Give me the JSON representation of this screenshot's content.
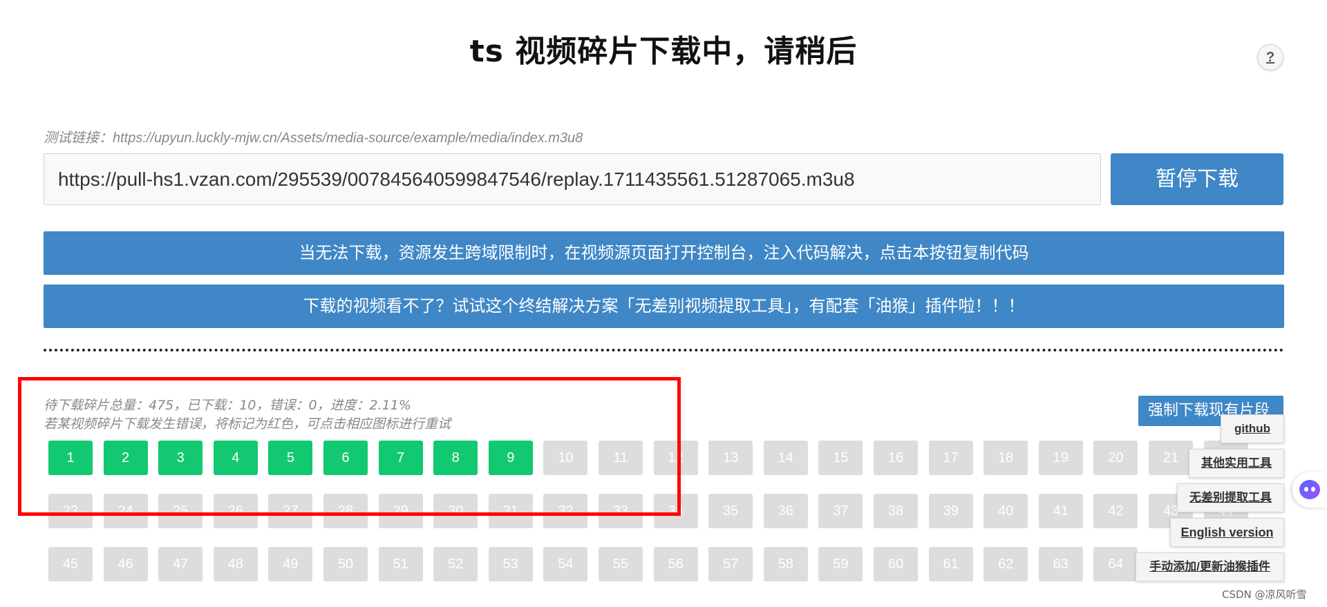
{
  "header": {
    "title": "ts 视频碎片下载中，请稍后",
    "help_label": "?"
  },
  "source": {
    "test_link": "测试链接：https://upyun.luckly-mjw.cn/Assets/media-source/example/media/index.m3u8",
    "url_value": "https://pull-hs1.vzan.com/295539/007845640599847546/replay.1711435561.51287065.m3u8",
    "pause_label": "暂停下载"
  },
  "actions": {
    "copy_code_label": "当无法下载，资源发生跨域限制时，在视频源页面打开控制台，注入代码解决，点击本按钮复制代码",
    "tool_promo_label": "下载的视频看不了？试试这个终结解决方案「无差别视频提取工具」，有配套「油猴」插件啦！！！",
    "force_download_label": "强制下载现有片段"
  },
  "progress": {
    "summary": "待下载碎片总量：475，已下载：10，错误：0，进度：2.11%",
    "hint": "若某视频碎片下载发生错误，将标记为红色，可点击相应图标进行重试",
    "total": 475,
    "downloaded": 10,
    "errors": 0,
    "percent": 2.11
  },
  "segments": [
    {
      "label": "1",
      "done": true
    },
    {
      "label": "2",
      "done": true
    },
    {
      "label": "3",
      "done": true
    },
    {
      "label": "4",
      "done": true
    },
    {
      "label": "5",
      "done": true
    },
    {
      "label": "6",
      "done": true
    },
    {
      "label": "7",
      "done": true
    },
    {
      "label": "8",
      "done": true
    },
    {
      "label": "9",
      "done": true
    },
    {
      "label": "10",
      "done": false
    },
    {
      "label": "11",
      "done": false
    },
    {
      "label": "12",
      "done": false
    },
    {
      "label": "13",
      "done": false
    },
    {
      "label": "14",
      "done": false
    },
    {
      "label": "15",
      "done": false
    },
    {
      "label": "16",
      "done": false
    },
    {
      "label": "17",
      "done": false
    },
    {
      "label": "18",
      "done": false
    },
    {
      "label": "19",
      "done": false
    },
    {
      "label": "20",
      "done": false
    },
    {
      "label": "21",
      "done": false
    },
    {
      "label": "22",
      "done": false
    },
    {
      "label": "23",
      "done": false
    },
    {
      "label": "24",
      "done": false
    },
    {
      "label": "25",
      "done": false
    },
    {
      "label": "26",
      "done": false
    },
    {
      "label": "27",
      "done": false
    },
    {
      "label": "28",
      "done": false
    },
    {
      "label": "29",
      "done": false
    },
    {
      "label": "30",
      "done": false
    },
    {
      "label": "31",
      "done": false
    },
    {
      "label": "32",
      "done": false
    },
    {
      "label": "33",
      "done": false
    },
    {
      "label": "34",
      "done": false
    },
    {
      "label": "35",
      "done": false
    },
    {
      "label": "36",
      "done": false
    },
    {
      "label": "37",
      "done": false
    },
    {
      "label": "38",
      "done": false
    },
    {
      "label": "39",
      "done": false
    },
    {
      "label": "40",
      "done": false
    },
    {
      "label": "41",
      "done": false
    },
    {
      "label": "42",
      "done": false
    },
    {
      "label": "43",
      "done": false
    },
    {
      "label": "44",
      "done": false
    },
    {
      "label": "45",
      "done": false
    },
    {
      "label": "46",
      "done": false
    },
    {
      "label": "47",
      "done": false
    },
    {
      "label": "48",
      "done": false
    },
    {
      "label": "49",
      "done": false
    },
    {
      "label": "50",
      "done": false
    },
    {
      "label": "51",
      "done": false
    },
    {
      "label": "52",
      "done": false
    },
    {
      "label": "53",
      "done": false
    },
    {
      "label": "54",
      "done": false
    },
    {
      "label": "55",
      "done": false
    },
    {
      "label": "56",
      "done": false
    },
    {
      "label": "57",
      "done": false
    },
    {
      "label": "58",
      "done": false
    },
    {
      "label": "59",
      "done": false
    },
    {
      "label": "60",
      "done": false
    },
    {
      "label": "61",
      "done": false
    },
    {
      "label": "62",
      "done": false
    },
    {
      "label": "63",
      "done": false
    },
    {
      "label": "64",
      "done": false
    }
  ],
  "side_menu": {
    "github": "github",
    "other_tools": "其他实用工具",
    "no_diff_tool": "无差别提取工具",
    "english": "English version",
    "manual_update": "手动添加/更新油猴插件"
  },
  "watermark": "CSDN @凉风听雪",
  "colors": {
    "primary_blue": "#3f87c6",
    "segment_done": "#12c870",
    "segment_pending": "#dddddd",
    "highlight_red": "#ff0000"
  }
}
